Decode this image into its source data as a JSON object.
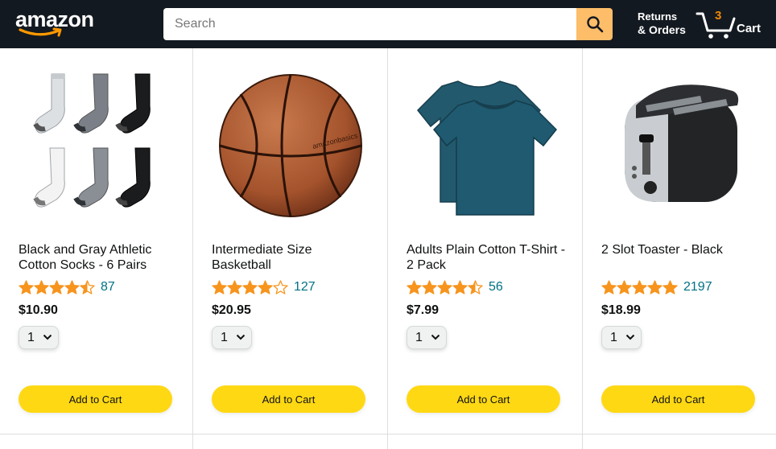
{
  "header": {
    "logo_text": "amazon",
    "search_placeholder": "Search",
    "orders_line1": "Returns",
    "orders_line2": "& Orders",
    "cart_count": "3",
    "cart_label": "Cart"
  },
  "products": [
    {
      "name": "Black and Gray Athletic Cotton Socks - 6 Pairs",
      "rating": 4.5,
      "rating_count": "87",
      "price": "$10.90",
      "quantity": "1",
      "add_label": "Add to Cart"
    },
    {
      "name": "Intermediate Size Basketball",
      "rating": 4.0,
      "rating_count": "127",
      "price": "$20.95",
      "quantity": "1",
      "add_label": "Add to Cart"
    },
    {
      "name": "Adults Plain Cotton T-Shirt - 2 Pack",
      "rating": 4.5,
      "rating_count": "56",
      "price": "$7.99",
      "quantity": "1",
      "add_label": "Add to Cart"
    },
    {
      "name": "2 Slot Toaster - Black",
      "rating": 5.0,
      "rating_count": "2197",
      "price": "$18.99",
      "quantity": "1",
      "add_label": "Add to Cart"
    }
  ],
  "colors": {
    "header_bg": "#131921",
    "search_button": "#febd69",
    "cart_count": "#f08804",
    "star": "#f7941d",
    "rating_link": "#007185",
    "add_button": "#ffd814"
  },
  "icons": [
    "search-icon",
    "cart-icon",
    "star-icon",
    "chevron-down-icon"
  ]
}
